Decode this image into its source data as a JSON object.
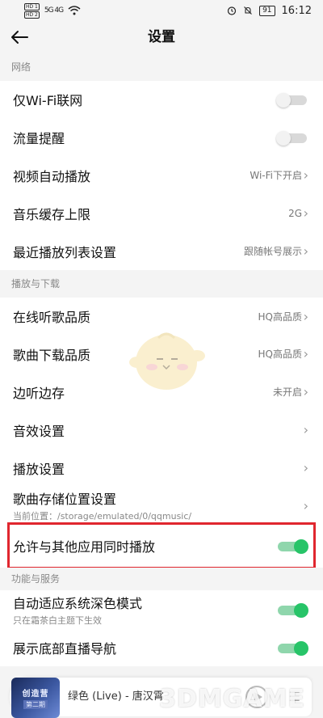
{
  "status": {
    "hd1": "HD 1",
    "hd2": "HD 2",
    "signal": "5G 4G",
    "battery": "91",
    "time": "16:12"
  },
  "header": {
    "title": "设置"
  },
  "sections": {
    "network": "网络",
    "playback": "播放与下载",
    "features": "功能与服务"
  },
  "rows": {
    "wifi_only": {
      "label": "仅Wi-Fi联网",
      "on": false
    },
    "data_reminder": {
      "label": "流量提醒",
      "on": false
    },
    "video_autoplay": {
      "label": "视频自动播放",
      "value": "Wi-Fi下开启"
    },
    "music_cache": {
      "label": "音乐缓存上限",
      "value": "2G"
    },
    "recent_list": {
      "label": "最近播放列表设置",
      "value": "跟随帐号展示"
    },
    "online_quality": {
      "label": "在线听歌品质",
      "value": "HQ高品质"
    },
    "download_quality": {
      "label": "歌曲下载品质",
      "value": "HQ高品质"
    },
    "listen_cache": {
      "label": "边听边存",
      "value": "未开启"
    },
    "sound_effects": {
      "label": "音效设置"
    },
    "play_settings": {
      "label": "播放设置"
    },
    "storage_location": {
      "label": "歌曲存储位置设置",
      "sub": "当前位置：/storage/emulated/0/qqmusic/"
    },
    "allow_simultaneous": {
      "label": "允许与其他应用同时播放",
      "on": true
    },
    "dark_mode": {
      "label": "自动适应系统深色模式",
      "sub": "只在霜茶白主题下生效",
      "on": true
    },
    "bottom_nav": {
      "label": "展示底部直播导航",
      "on": true
    }
  },
  "player": {
    "song": "绿色 (Live) - 唐汉霄",
    "cover_title": "创造营",
    "cover_sub": "第二期"
  },
  "watermark": "3DMGAME",
  "colors": {
    "accent": "#27c468",
    "highlight": "#e0262e"
  }
}
